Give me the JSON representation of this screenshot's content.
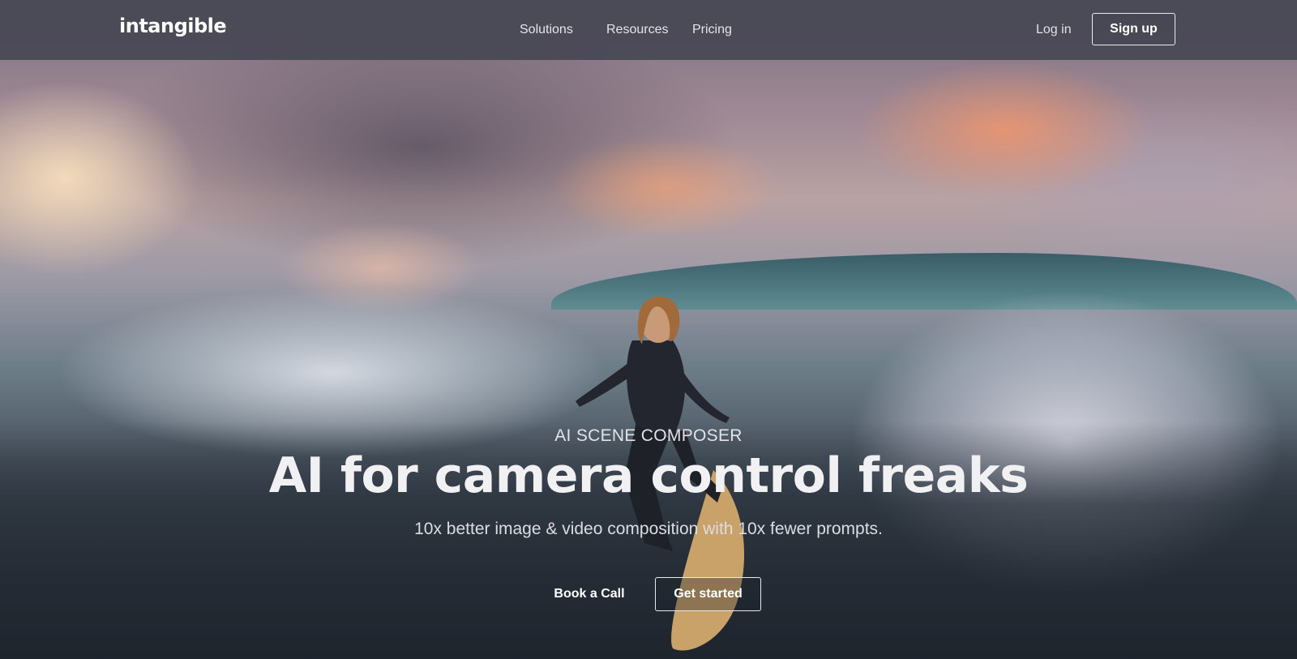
{
  "brand": {
    "logo_text": "intangible"
  },
  "nav": {
    "items": [
      {
        "label": "Solutions"
      },
      {
        "label": "Resources"
      },
      {
        "label": "Pricing"
      }
    ],
    "login_label": "Log in",
    "signup_label": "Sign up"
  },
  "hero": {
    "eyebrow": "AI SCENE COMPOSER",
    "headline": "AI for camera control freaks",
    "subheadline": "10x better image & video composition with 10x fewer prompts.",
    "book_call_label": "Book a Call",
    "get_started_label": "Get started"
  },
  "colors": {
    "nav_background": "#464654",
    "text_primary": "#ffffff",
    "button_border": "#e9e9ef"
  }
}
